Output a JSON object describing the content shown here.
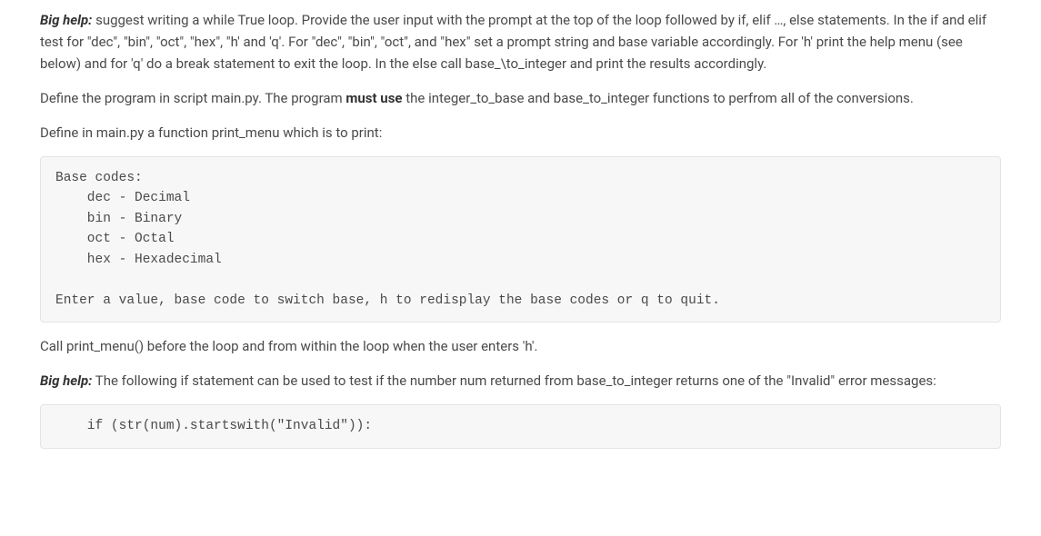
{
  "para1": {
    "label": "Big help:",
    "text": " suggest writing a while True loop. Provide the user input with the prompt at the top of the loop followed by if, elif …, else statements. In the if and elif test for \"dec\", \"bin\", \"oct\", \"hex\", \"h' and 'q'. For \"dec\", \"bin\", \"oct\", and \"hex\" set a prompt string and base variable accordingly. For 'h' print the help menu (see below) and for 'q' do a break statement to exit the loop. In the else call base_\\to_integer and print the results accordingly."
  },
  "para2": {
    "pre": "Define the program in script main.py. The program ",
    "bold": "must use",
    "post": " the integer_to_base and base_to_integer functions to perfrom all of the conversions."
  },
  "para3": "Define in main.py a function print_menu which is to print:",
  "codeblock1": "Base codes:\n    dec - Decimal\n    bin - Binary\n    oct - Octal\n    hex - Hexadecimal\n\nEnter a value, base code to switch base, h to redisplay the base codes or q to quit.",
  "para4": "Call print_menu() before the loop and from within the loop when the user enters 'h'.",
  "para5": {
    "label": "Big help:",
    "text": " The following if statement can be used to test if the number num returned from base_to_integer returns one of the \"Invalid\" error messages:"
  },
  "codeblock2": "    if (str(num).startswith(\"Invalid\")):"
}
